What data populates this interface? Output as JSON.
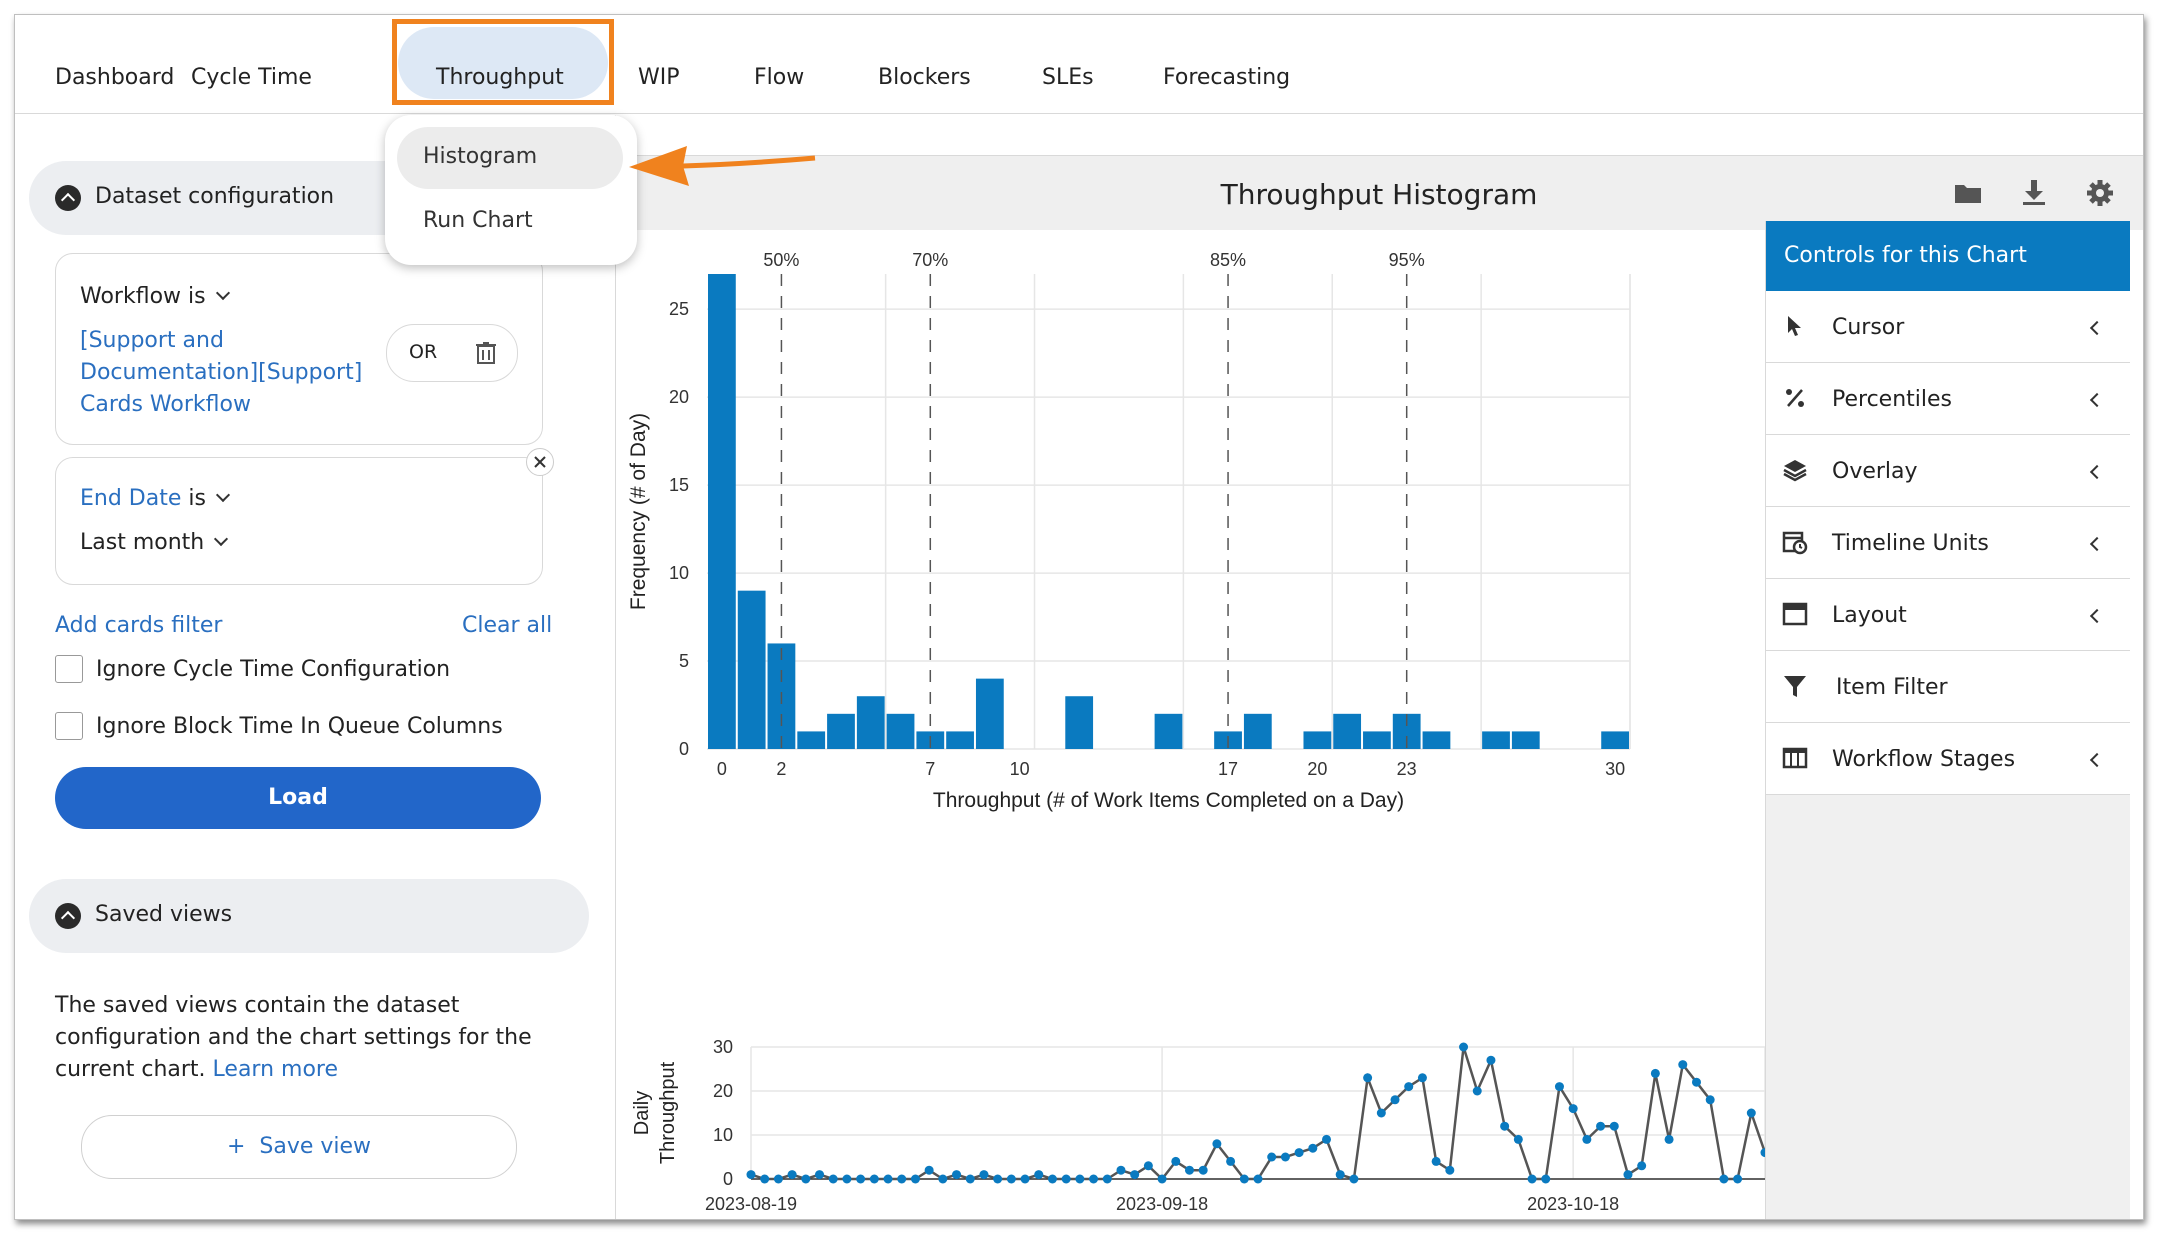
{
  "nav": {
    "tabs": [
      "Dashboard",
      "Cycle Time",
      "Throughput",
      "WIP",
      "Flow",
      "Blockers",
      "SLEs",
      "Forecasting"
    ]
  },
  "dropdown": {
    "items": [
      "Histogram",
      "Run Chart"
    ]
  },
  "dataset": {
    "title": "Dataset configuration",
    "workflow_label": "Workflow is",
    "workflow_value": [
      "[Support and",
      "Documentation][Support]",
      "Cards Workflow"
    ],
    "or_label": "OR",
    "end_date_label": "End Date",
    "end_date_is": "is",
    "end_date_value": "Last month",
    "add_filter": "Add cards filter",
    "clear_all": "Clear all",
    "ignore_cycle": "Ignore Cycle Time Configuration",
    "ignore_block": "Ignore Block Time In Queue Columns",
    "load": "Load"
  },
  "saved_views": {
    "title": "Saved views",
    "desc": [
      "The saved views contain the dataset",
      "configuration and the chart settings for the",
      "current chart."
    ],
    "learn_more": "Learn more",
    "save_view": "Save view"
  },
  "chart_header": {
    "title": "Throughput Histogram"
  },
  "controls": {
    "title": "Controls for this Chart",
    "items": [
      "Cursor",
      "Percentiles",
      "Overlay",
      "Timeline Units",
      "Layout",
      "Item Filter",
      "Workflow Stages"
    ]
  },
  "colors": {
    "accent_blue": "#0a7ac0",
    "load_blue": "#2266c9",
    "highlight_orange": "#f0821e",
    "bar": "#0a7ac0"
  },
  "chart_data": [
    {
      "type": "bar",
      "title": "Throughput Histogram",
      "xlabel": "Throughput (# of Work Items Completed on a Day)",
      "ylabel": "Frequency (# of Day)",
      "x_ticks": [
        0,
        2,
        7,
        10,
        17,
        20,
        23,
        30
      ],
      "y_ticks": [
        0,
        5,
        10,
        15,
        20,
        25
      ],
      "xlim": [
        -0.5,
        30.5
      ],
      "ylim": [
        0,
        27
      ],
      "bars": [
        {
          "x": 0,
          "y": 27
        },
        {
          "x": 1,
          "y": 9
        },
        {
          "x": 2,
          "y": 6
        },
        {
          "x": 3,
          "y": 1
        },
        {
          "x": 4,
          "y": 2
        },
        {
          "x": 5,
          "y": 3
        },
        {
          "x": 6,
          "y": 2
        },
        {
          "x": 7,
          "y": 1
        },
        {
          "x": 8,
          "y": 1
        },
        {
          "x": 9,
          "y": 4
        },
        {
          "x": 12,
          "y": 3
        },
        {
          "x": 15,
          "y": 2
        },
        {
          "x": 17,
          "y": 1
        },
        {
          "x": 18,
          "y": 2
        },
        {
          "x": 20,
          "y": 1
        },
        {
          "x": 21,
          "y": 2
        },
        {
          "x": 22,
          "y": 1
        },
        {
          "x": 23,
          "y": 2
        },
        {
          "x": 24,
          "y": 1
        },
        {
          "x": 26,
          "y": 1
        },
        {
          "x": 27,
          "y": 1
        },
        {
          "x": 30,
          "y": 1
        }
      ],
      "percentiles": [
        {
          "label": "50%",
          "x": 2
        },
        {
          "label": "70%",
          "x": 7
        },
        {
          "label": "85%",
          "x": 17
        },
        {
          "label": "95%",
          "x": 23
        }
      ]
    },
    {
      "type": "line",
      "ylabel": [
        "Daily",
        "Throughput"
      ],
      "y_ticks": [
        0,
        10,
        20,
        30
      ],
      "ylim": [
        0,
        30
      ],
      "x_ticks": [
        {
          "label": "2023-08-19",
          "day": 0
        },
        {
          "label": "2023-09-18",
          "day": 30
        },
        {
          "label": "2023-10-18",
          "day": 60
        }
      ],
      "values": [
        1,
        0,
        0,
        1,
        0,
        1,
        0,
        0,
        0,
        0,
        0,
        0,
        0,
        2,
        0,
        1,
        0,
        1,
        0,
        0,
        0,
        1,
        0,
        0,
        0,
        0,
        0,
        2,
        1,
        3,
        0,
        4,
        2,
        2,
        8,
        4,
        0,
        0,
        5,
        5,
        6,
        7,
        9,
        1,
        0,
        23,
        15,
        18,
        21,
        23,
        4,
        2,
        30,
        20,
        27,
        12,
        9,
        0,
        0,
        21,
        16,
        9,
        12,
        12,
        1,
        3,
        24,
        9,
        26,
        22,
        18,
        0,
        0,
        15,
        6
      ]
    }
  ]
}
